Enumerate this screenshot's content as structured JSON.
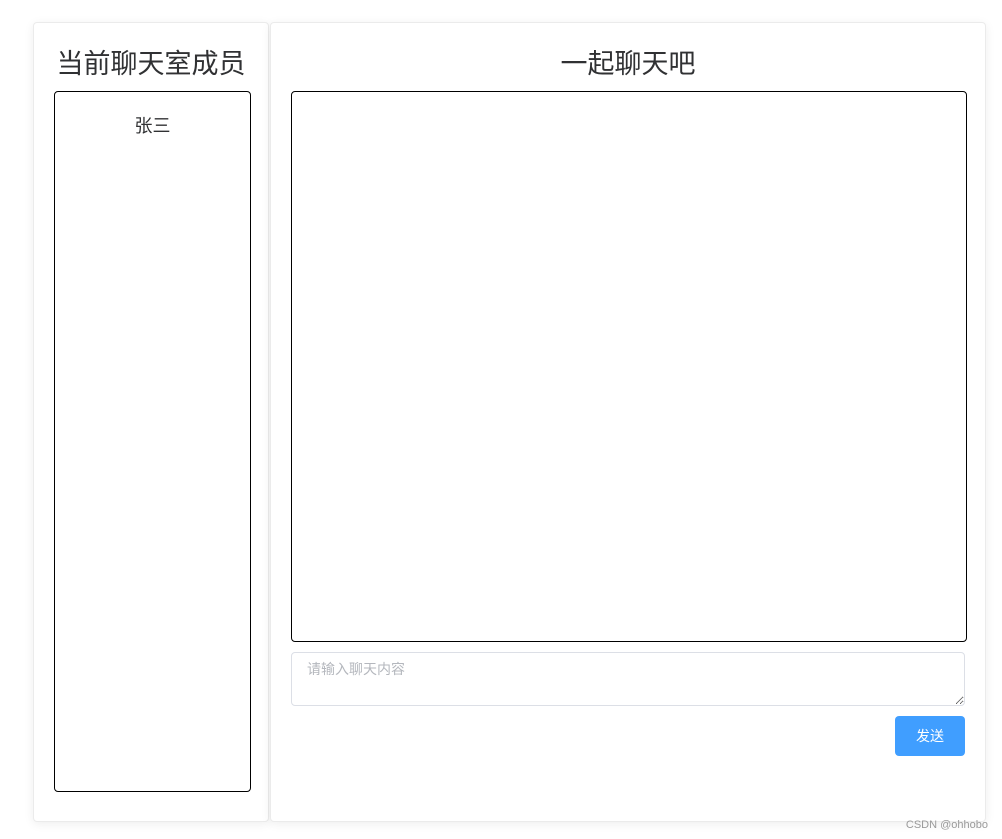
{
  "members_panel": {
    "title": "当前聊天室成员",
    "members": [
      {
        "name": "张三"
      }
    ]
  },
  "chat_panel": {
    "title": "一起聊天吧",
    "input": {
      "value": "",
      "placeholder": "请输入聊天内容"
    },
    "send_label": "发送"
  },
  "watermark": "CSDN @ohhobo",
  "colors": {
    "accent": "#409eff",
    "text": "#303133",
    "border": "#000000"
  }
}
